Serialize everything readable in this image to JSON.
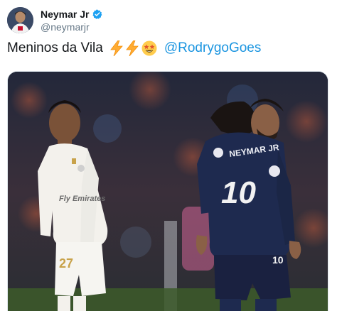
{
  "author": {
    "display_name": "Neymar Jr",
    "handle": "@neymarjr",
    "verified": true
  },
  "tweet": {
    "text": "Meninos da Vila",
    "emojis": [
      "high-voltage",
      "high-voltage",
      "star-struck"
    ],
    "mention": "@RodrygoGoes"
  },
  "media": {
    "description_icons": [
      "photo"
    ],
    "left_shirt_text": "Fly Emirates",
    "left_shorts_number": "27",
    "right_shirt_name": "NEYMAR JR",
    "right_shirt_number": "10"
  },
  "colors": {
    "name": "#14171a",
    "handle": "#657786",
    "link": "#1b95e0",
    "verified": "#1da1f2",
    "psg_navy": "#1e2a4f"
  }
}
